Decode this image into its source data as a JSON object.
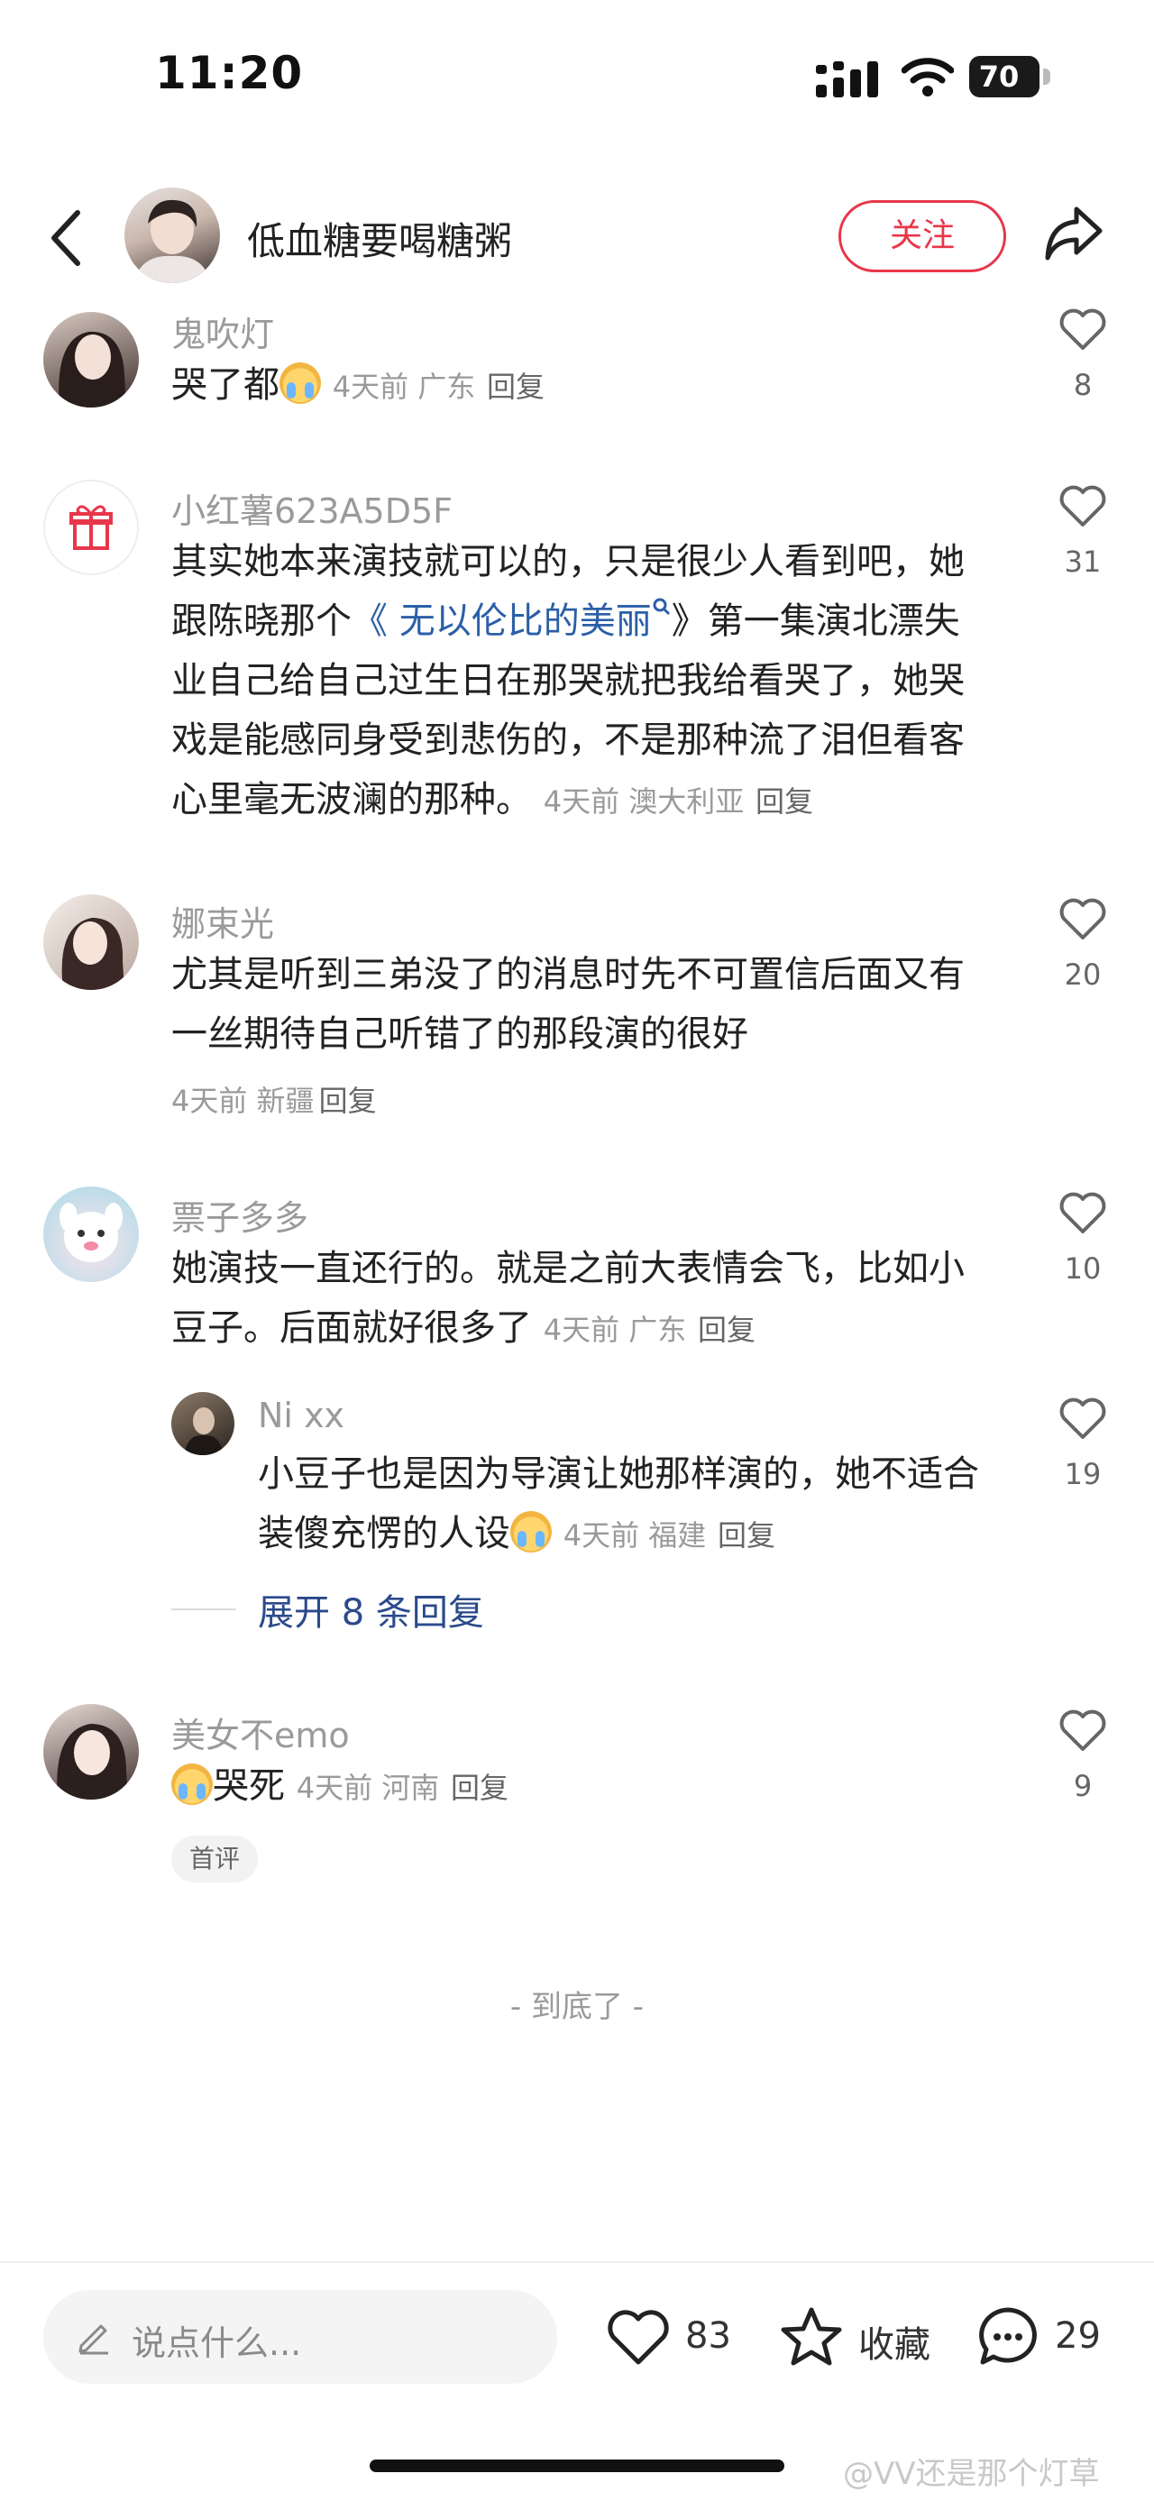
{
  "status_bar": {
    "time": "11:20",
    "battery": "70"
  },
  "header": {
    "username": "低血糖要喝糖粥",
    "follow_label": "关注"
  },
  "comments": [
    {
      "user": "鬼吹灯",
      "text": "哭了都",
      "meta": "4天前 广东",
      "reply": "回复",
      "likes": "8"
    },
    {
      "user": "小红薯623A5D5F",
      "lines": [
        "其实她本来演技就可以的，只是很少人看到吧，她",
        "跟陈晓那个",
        "《 无以伦比的美丽",
        "》第一集演北漂失",
        "业自己给自己过生日在那哭就把我给看哭了，她哭",
        "戏是能感同身受到悲伤的，不是那种流了泪但看客",
        "心里毫无波澜的那种。"
      ],
      "meta": "4天前 澳大利亚",
      "reply": "回复",
      "likes": "31"
    },
    {
      "user": "娜束光",
      "lines": [
        "尤其是听到三弟没了的消息时先不可置信后面又有",
        "一丝期待自己听错了的那段演的很好"
      ],
      "meta": "4天前 新疆",
      "reply": "回复",
      "likes": "20"
    },
    {
      "user": "票子多多",
      "lines": [
        "她演技一直还行的。就是之前大表情会飞，比如小",
        "豆子。后面就好很多了"
      ],
      "meta": "4天前 广东",
      "reply": "回复",
      "likes": "10"
    },
    {
      "user": "美女不emo",
      "text": "哭死",
      "meta": "4天前 河南",
      "reply": "回复",
      "likes": "9",
      "badge": "首评"
    }
  ],
  "sub_reply": {
    "user": "Ni xx",
    "lines": [
      "小豆子也是因为导演让她那样演的，她不适合",
      "装傻充愣的人设"
    ],
    "meta": "4天前 福建",
    "reply": "回复",
    "likes": "19"
  },
  "expand_label": "展开 8 条回复",
  "end_label": "- 到底了 -",
  "bottom_bar": {
    "input_placeholder": "说点什么...",
    "likes": "83",
    "collect_label": "收藏",
    "comments": "29"
  },
  "watermark": "@VV还是那个灯草",
  "colors": {
    "accent": "#e8364a",
    "link": "#2b5fa8"
  }
}
